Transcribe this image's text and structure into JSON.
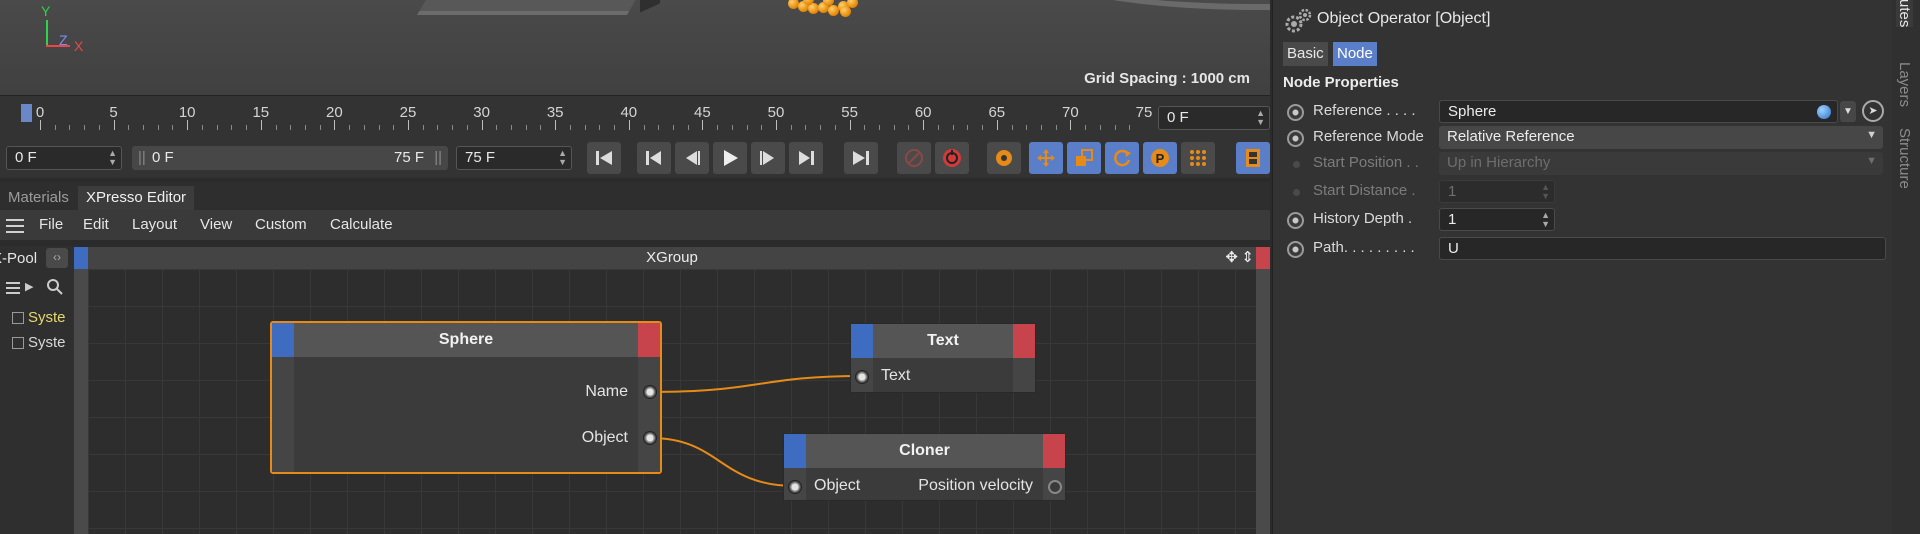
{
  "viewport": {
    "axis_y": "Y",
    "axis_z": "Z",
    "axis_x": "X",
    "grid_spacing": "Grid Spacing : 1000 cm"
  },
  "timeline": {
    "ticks": [
      "0",
      "5",
      "10",
      "15",
      "20",
      "25",
      "30",
      "35",
      "40",
      "45",
      "50",
      "55",
      "60",
      "65",
      "70",
      "75"
    ],
    "current_frame": "0 F"
  },
  "transport": {
    "start_frame": "0 F",
    "range_start": "0 F",
    "range_end": "75 F",
    "end_frame": "75 F"
  },
  "tabs": [
    {
      "label": "Materials"
    },
    {
      "label": "XPresso Editor"
    }
  ],
  "menu": [
    "File",
    "Edit",
    "Layout",
    "View",
    "Custom",
    "Calculate"
  ],
  "xpool": {
    "title": "X-Pool",
    "items": [
      "Syste",
      "Syste"
    ]
  },
  "xgroup": {
    "title": "XGroup",
    "nodes": {
      "sphere": {
        "title": "Sphere",
        "ports": [
          "Name",
          "Object"
        ]
      },
      "text": {
        "title": "Text",
        "ports": [
          "Text"
        ]
      },
      "cloner": {
        "title": "Cloner",
        "in_port": "Object",
        "out_port": "Position velocity"
      }
    }
  },
  "attributes": {
    "title": "Object Operator [Object]",
    "tabs": [
      "Basic",
      "Node"
    ],
    "section": "Node Properties",
    "props": {
      "reference": {
        "label": "Reference . . . .",
        "value": "Sphere"
      },
      "reference_mode": {
        "label": "Reference Mode",
        "value": "Relative Reference"
      },
      "start_position": {
        "label": "Start Position . .",
        "value": "Up in Hierarchy"
      },
      "start_distance": {
        "label": "Start Distance .",
        "value": "1"
      },
      "history_depth": {
        "label": "History Depth .",
        "value": "1"
      },
      "path": {
        "label": "Path. . . . . . . . .",
        "value": "U"
      }
    }
  },
  "side_tabs": [
    "Attributes",
    "Layers",
    "Structure"
  ],
  "colors": {
    "accent_blue": "#5b7ec9",
    "port_in": "#3e6cc0",
    "port_out": "#c8444c",
    "wire": "#e68a18",
    "selection": "#e68a18"
  }
}
